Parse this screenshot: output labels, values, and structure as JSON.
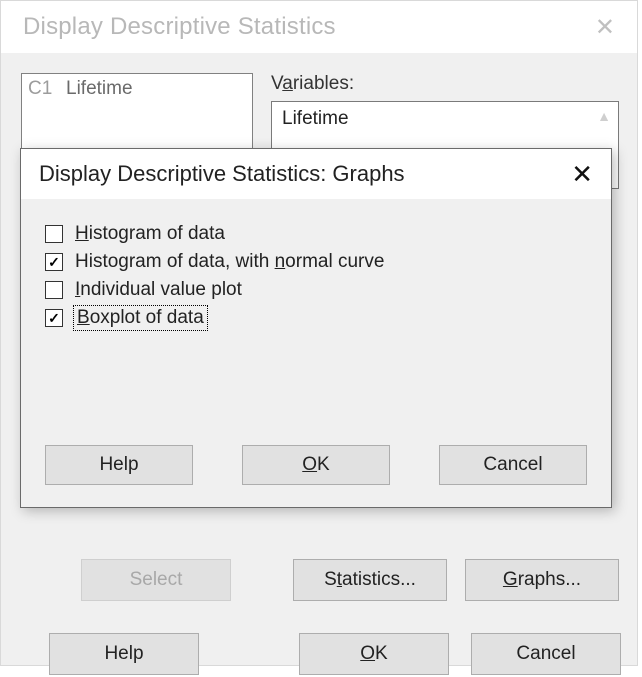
{
  "main": {
    "title": "Display Descriptive Statistics",
    "close_glyph": "✕",
    "column_list": {
      "col_id": "C1",
      "col_name": "Lifetime"
    },
    "variables_label_pre": "V",
    "variables_label_u": "a",
    "variables_label_post": "riables:",
    "variables_value": "Lifetime",
    "buttons": {
      "select": "Select",
      "statistics_pre": "S",
      "statistics_u": "t",
      "statistics_post": "atistics...",
      "graphs_u": "G",
      "graphs_post": "raphs...",
      "help": "Help",
      "ok_u": "O",
      "ok_post": "K",
      "cancel": "Cancel"
    }
  },
  "modal": {
    "title": "Display Descriptive Statistics: Graphs",
    "close_glyph": "✕",
    "options": {
      "histogram_u": "H",
      "histogram_post": "istogram of data",
      "norm_pre": "Histogram of data, with ",
      "norm_u": "n",
      "norm_post": "ormal curve",
      "indiv_u": "I",
      "indiv_post": "ndividual value plot",
      "box_u": "B",
      "box_post": "oxplot of data"
    },
    "checked": {
      "histogram": false,
      "normal": true,
      "individual": false,
      "boxplot": true
    },
    "buttons": {
      "help": "Help",
      "ok_u": "O",
      "ok_post": "K",
      "cancel": "Cancel"
    }
  }
}
